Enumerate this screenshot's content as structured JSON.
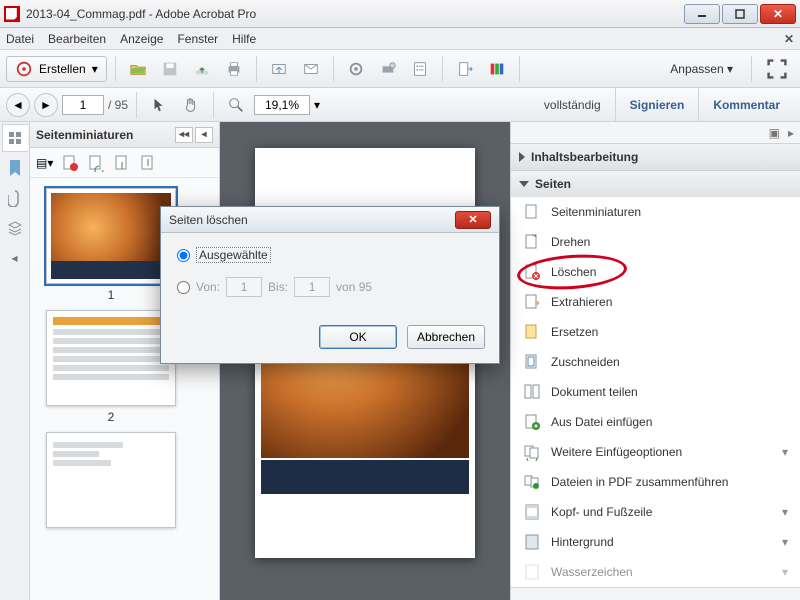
{
  "window": {
    "title": "2013-04_Commag.pdf - Adobe Acrobat Pro"
  },
  "menu": {
    "file": "Datei",
    "edit": "Bearbeiten",
    "view": "Anzeige",
    "window": "Fenster",
    "help": "Hilfe"
  },
  "toolbar": {
    "create": "Erstellen",
    "customize": "Anpassen"
  },
  "nav": {
    "page": "1",
    "total": "/  95",
    "zoom": "19,1%"
  },
  "rightlinks": {
    "complete": "vollständig",
    "sign": "Signieren",
    "comment": "Kommentar"
  },
  "thumbs": {
    "title": "Seitenminiaturen",
    "p1": "1",
    "p2": "2"
  },
  "tools": {
    "acc1": "Inhaltsbearbeitung",
    "acc2": "Seiten",
    "items": [
      "Seitenminiaturen",
      "Drehen",
      "Löschen",
      "Extrahieren",
      "Ersetzen",
      "Zuschneiden",
      "Dokument teilen",
      "Aus Datei einfügen",
      "Weitere Einfügeoptionen",
      "Dateien in PDF zusammenführen",
      "Kopf- und Fußzeile",
      "Hintergrund",
      "Wasserzeichen"
    ]
  },
  "dialog": {
    "title": "Seiten löschen",
    "selected": "Ausgewählte",
    "from": "Von:",
    "to": "Bis:",
    "ofTotal": "von 95",
    "fromVal": "1",
    "toVal": "1",
    "ok": "OK",
    "cancel": "Abbrechen"
  }
}
